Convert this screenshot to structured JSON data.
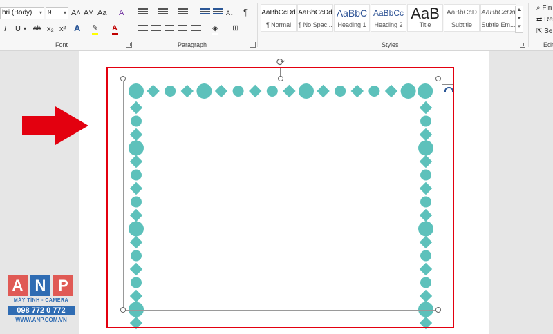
{
  "font_group": {
    "label": "Font",
    "font_name": "bri (Body)",
    "font_size": "9",
    "grow_glyph": "A˄",
    "shrink_glyph": "A˅",
    "case_glyph": "Aa",
    "clear_glyph": "A",
    "italic": "I",
    "underline": "U",
    "strike": "ab",
    "subscript": "x₂",
    "superscript": "x²",
    "effects": "A",
    "highlight": "✎",
    "font_color": "A"
  },
  "paragraph_group": {
    "label": "Paragraph",
    "sort_glyph": "A↓",
    "pilcrow": "¶"
  },
  "styles_group": {
    "label": "Styles",
    "tiles": [
      {
        "sample": "AaBbCcDd",
        "name": "¶ Normal"
      },
      {
        "sample": "AaBbCcDd",
        "name": "¶ No Spac..."
      },
      {
        "sample": "AaBbC",
        "name": "Heading 1"
      },
      {
        "sample": "AaBbCc",
        "name": "Heading 2"
      },
      {
        "sample": "AaB",
        "name": "Title"
      },
      {
        "sample": "AaBbCcD",
        "name": "Subtitle"
      },
      {
        "sample": "AaBbCcDd",
        "name": "Subtle Em..."
      }
    ]
  },
  "editing_group": {
    "label": "Edit",
    "find": "Fin",
    "replace": "Re",
    "select": "Sel"
  },
  "logo": {
    "letters": [
      "A",
      "N",
      "P"
    ],
    "tagline": "MÁY TÍNH - CAMERA",
    "phone": "098 772 0 772",
    "website": "WWW.ANP.COM.VN"
  },
  "colors": {
    "shape_fill": "#5dc1bb",
    "highlight_red": "#e3000f",
    "logo_blue": "#2f6cb3",
    "logo_red": "#e05a55"
  },
  "icons": {
    "rotate": "⟳"
  }
}
